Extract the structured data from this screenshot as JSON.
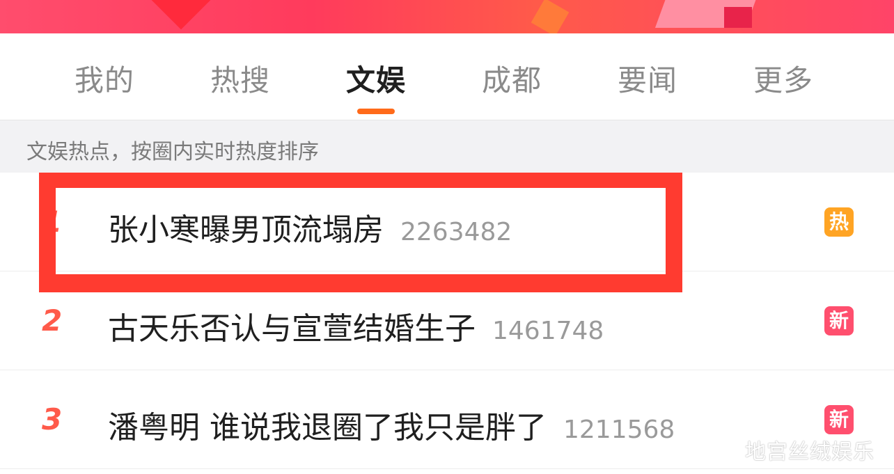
{
  "tabs": [
    {
      "label": "我的"
    },
    {
      "label": "热搜"
    },
    {
      "label": "文娱",
      "active": true
    },
    {
      "label": "成都"
    },
    {
      "label": "要闻"
    },
    {
      "label": "更多"
    }
  ],
  "subheader": {
    "text": "文娱热点，按圈内实时热度排序"
  },
  "list": [
    {
      "rank": "1",
      "title": "张小寒曝男顶流塌房",
      "count": "2263482",
      "badge": "热",
      "badge_type": "hot"
    },
    {
      "rank": "2",
      "title": "古天乐否认与宣萱结婚生子",
      "count": "1461748",
      "badge": "新",
      "badge_type": "new"
    },
    {
      "rank": "3",
      "title": "潘粤明 谁说我退圈了我只是胖了",
      "count": "1211568",
      "badge": "新",
      "badge_type": "new"
    }
  ],
  "watermark": "地宫丝绒娱乐",
  "colors": {
    "accent": "#ff6a1a",
    "rank": "#ff5a4a",
    "hot_badge": "#ffa424",
    "new_badge": "#ff4f6e",
    "highlight": "#ff3b30"
  }
}
